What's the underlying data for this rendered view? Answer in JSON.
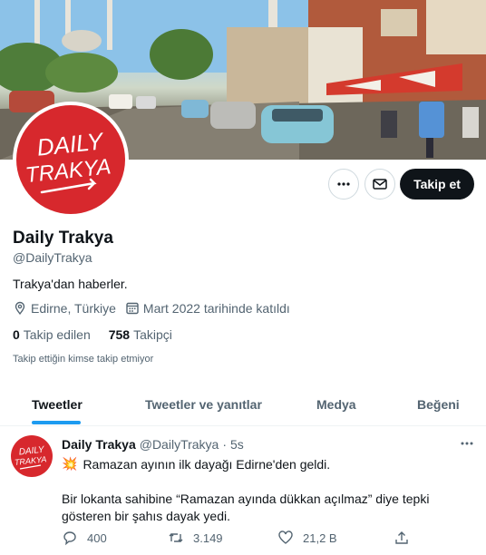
{
  "profile": {
    "avatar_text": [
      "DAILY",
      "TRAKYA"
    ],
    "name": "Daily Trakya",
    "handle": "@DailyTrakya",
    "bio": "Trakya'dan haberler.",
    "location": "Edirne, Türkiye",
    "joined": "Mart 2022 tarihinde katıldı",
    "following_count": "0",
    "following_label": "Takip edilen",
    "followers_count": "758",
    "followers_label": "Takipçi",
    "follow_notice": "Takip ettiğin kimse takip etmiyor"
  },
  "actions": {
    "follow_label": "Takip et",
    "more_icon": "more-icon",
    "message_icon": "mail-icon"
  },
  "tabs": [
    {
      "label": "Tweetler",
      "active": true
    },
    {
      "label": "Tweetler ve yanıtlar",
      "active": false
    },
    {
      "label": "Medya",
      "active": false
    },
    {
      "label": "Beğeni",
      "active": false
    }
  ],
  "tweet": {
    "name": "Daily Trakya",
    "handle": "@DailyTrakya",
    "separator": "·",
    "time": "5s",
    "emoji": "💥",
    "line1": "Ramazan ayının ilk dayağı Edirne'den geldi.",
    "line2": "Bir lokanta sahibine “Ramazan ayında dükkan açılmaz” diye tepki gösteren bir şahıs dayak yedi.",
    "replies": "400",
    "retweets": "3.149",
    "likes": "21,2 B"
  },
  "colors": {
    "accent": "#1d9bf0",
    "brand_red": "#d7282d",
    "text_primary": "#0f1419",
    "text_secondary": "#536471"
  }
}
